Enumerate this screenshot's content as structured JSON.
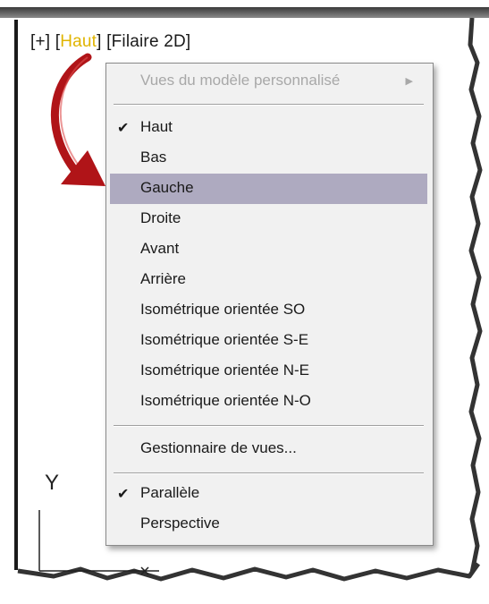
{
  "viewport": {
    "label_open": "[+] [",
    "view": "Haut",
    "label_mid": "] [",
    "style": "Filaire 2D",
    "label_close": "]",
    "ucs_y": "Y"
  },
  "menu": {
    "custom_views": "Vues du modèle personnalisé",
    "views": [
      "Haut",
      "Bas",
      "Gauche",
      "Droite",
      "Avant",
      "Arrière",
      "Isométrique orientée SO",
      "Isométrique orientée S-E",
      "Isométrique orientée N-E",
      "Isométrique orientée N-O"
    ],
    "view_manager": "Gestionnaire de vues...",
    "projection": [
      "Parallèle",
      "Perspective"
    ],
    "checked_view": "Haut",
    "checked_projection": "Parallèle",
    "highlighted_item": "Gauche"
  },
  "colors": {
    "highlight": "#aeaac0",
    "view_label": "#e0b400",
    "arrow": "#b01418"
  }
}
